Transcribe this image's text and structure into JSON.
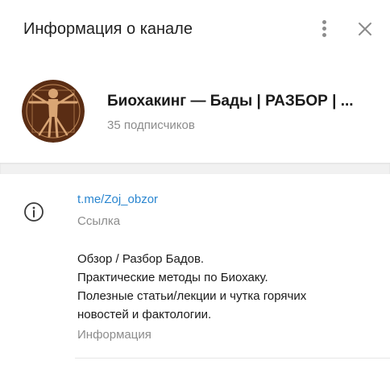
{
  "header": {
    "title": "Информация о канале",
    "menu_icon": "more-vertical-icon",
    "close_icon": "close-icon"
  },
  "channel": {
    "name": "Биохакинг — Бады | РАЗБОР | ...",
    "subscribers": "35 подписчиков",
    "avatar_icon": "vitruvian-man-avatar"
  },
  "info": {
    "icon": "info-icon",
    "link": "t.me/Zoj_obzor",
    "link_caption": "Ссылка",
    "description_lines": [
      "Обзор / Разбор Бадов.",
      "Практические методы по Биохаку.",
      "Полезные статьи/лекции и чутка горячих",
      "новостей и фактологии."
    ],
    "description_caption": "Информация"
  },
  "colors": {
    "link": "#2a86d0",
    "secondary_text": "#8c8c8c",
    "avatar_bg": "#5a2d14",
    "avatar_figure": "#d9a574",
    "divider_band": "#f1f1f1"
  }
}
